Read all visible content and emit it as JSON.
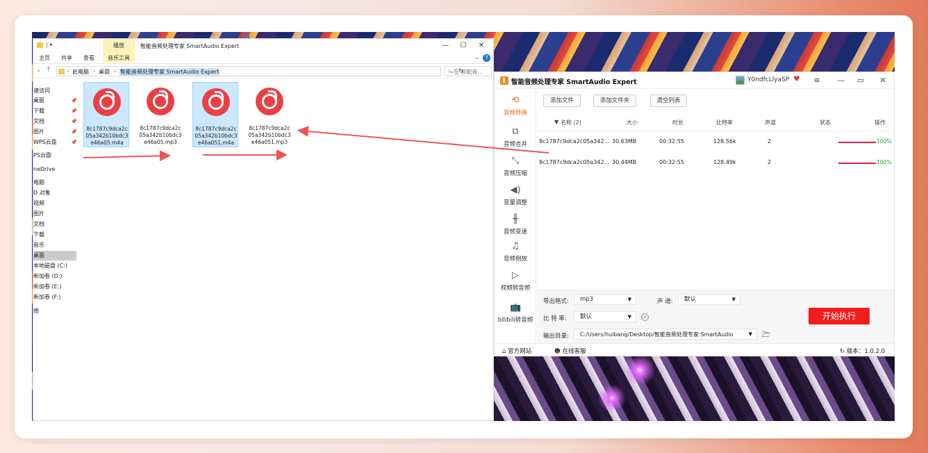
{
  "explorer": {
    "title": "智能音频处理专家 SmartAudio Expert",
    "context_tab": "播放",
    "ribbon_tabs": [
      "主页",
      "共享",
      "查看",
      "音乐工具"
    ],
    "path": [
      "此电脑",
      "桌面",
      "智能音频处理专家 SmartAudio Expert"
    ],
    "search_placeholder": "在 智能音...",
    "nav_items": [
      {
        "label": "速访问",
        "pinned": false
      },
      {
        "label": "桌面",
        "pinned": true
      },
      {
        "label": "下载",
        "pinned": true
      },
      {
        "label": "文档",
        "pinned": true
      },
      {
        "label": "图片",
        "pinned": true
      },
      {
        "label": "WPS云盘",
        "pinned": true
      },
      {
        "label": "PS云盘",
        "pinned": false
      },
      {
        "label": "neDrive",
        "pinned": false
      },
      {
        "label": "电脑",
        "pinned": false
      },
      {
        "label": "D 对象",
        "pinned": false
      },
      {
        "label": "视频",
        "pinned": false
      },
      {
        "label": "图片",
        "pinned": false
      },
      {
        "label": "文档",
        "pinned": false
      },
      {
        "label": "下载",
        "pinned": false
      },
      {
        "label": "音乐",
        "pinned": false
      },
      {
        "label": "桌面",
        "pinned": false
      },
      {
        "label": "本地磁盘 (C:)",
        "pinned": false
      },
      {
        "label": "新加卷 (D:)",
        "pinned": false
      },
      {
        "label": "新加卷 (E:)",
        "pinned": false
      },
      {
        "label": "新加卷 (F:)",
        "pinned": false
      },
      {
        "label": "络",
        "pinned": false
      }
    ],
    "files": [
      {
        "name": "8c1787c9dca2c05a342b10bdc3e46a05.m4a",
        "selected": true
      },
      {
        "name": "8c1787c9dca2c05a342b10bdc3e46a05.mp3",
        "selected": false
      },
      {
        "name": "8c1787c9dca2c05a342b10bdc3e46a051.m4a",
        "selected": true
      },
      {
        "name": "8c1787c9dca2c05a342b10bdc3e46a051.mp3",
        "selected": false
      }
    ]
  },
  "app": {
    "title": "智能音频处理专家 SmartAudio Expert",
    "user": "Y0ndfcLlyaSP",
    "sidebar": [
      {
        "label": "音频转换",
        "icon": "convert-icon",
        "active": true
      },
      {
        "label": "音频合并",
        "icon": "merge-icon",
        "active": false
      },
      {
        "label": "音频压缩",
        "icon": "compress-icon",
        "active": false
      },
      {
        "label": "音量调整",
        "icon": "volume-icon",
        "active": false
      },
      {
        "label": "音频变速",
        "icon": "speed-icon",
        "active": false
      },
      {
        "label": "音频倒放",
        "icon": "music-note-icon",
        "active": false
      },
      {
        "label": "视频转音频",
        "icon": "play-circle-icon",
        "active": false
      },
      {
        "label": "bilibili转音频",
        "icon": "bilibili-icon",
        "active": false
      }
    ],
    "toolbar": {
      "add_file": "添加文件",
      "add_folder": "添加文件夹",
      "clear_list": "清空列表"
    },
    "table": {
      "headers": {
        "name": "名称 (2)",
        "size": "大小",
        "duration": "时长",
        "bitrate": "比特率",
        "channels": "声道",
        "status": "状态",
        "action": "操作"
      },
      "rows": [
        {
          "name": "8c1787c9dca2c05a342...",
          "size": "30.63MB",
          "duration": "00:32:55",
          "bitrate": "128.56k",
          "channels": "2",
          "progress": "100%"
        },
        {
          "name": "8c1787c9dca2c05a342...",
          "size": "30.44MB",
          "duration": "00:32:55",
          "bitrate": "128.49k",
          "channels": "2",
          "progress": "100%"
        }
      ]
    },
    "settings": {
      "format_label": "导出格式:",
      "format_value": "mp3",
      "channel_label": "声 道:",
      "channel_value": "默认",
      "bitrate_label": "比 特 率:",
      "bitrate_value": "默认",
      "output_label": "输出目录:",
      "output_value": "C:/Users/huibang/Desktop/智能音频处理专家 SmartAudio",
      "start_button": "开始执行"
    },
    "footer": {
      "website": "官方网站",
      "support": "在线客服",
      "version": "版本：1.0.2.0"
    }
  },
  "colors": {
    "accent": "#f2671f",
    "start_button": "#f31d1d",
    "progress": "#e0194e",
    "arrow": "#ee5555"
  }
}
